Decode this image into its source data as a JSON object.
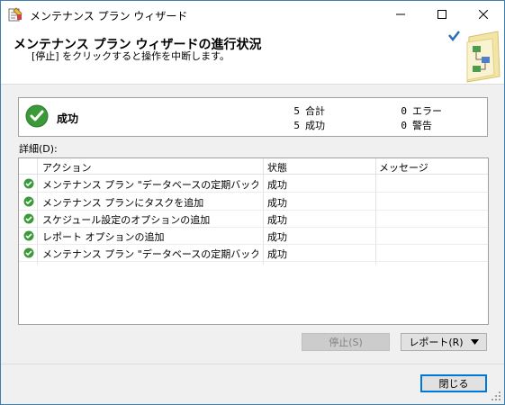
{
  "window": {
    "title": "メンテナンス プラン ウィザード",
    "controls": [
      "minimize-icon",
      "maximize-icon",
      "close-icon"
    ]
  },
  "header": {
    "title": "メンテナンス プラン ウィザードの進行状況",
    "subtitle": "[停止] をクリックすると操作を中断します。"
  },
  "status": {
    "label": "成功",
    "total_count": "5",
    "total_label": "合計",
    "success_count": "5",
    "success_label": "成功",
    "error_count": "0",
    "error_label": "エラー",
    "warning_count": "0",
    "warning_label": "警告"
  },
  "details": {
    "label": "詳細(D):",
    "columns": [
      "アクション",
      "状態",
      "メッセージ"
    ],
    "rows": [
      {
        "action": "メンテナンス プラン \"データベースの定期バックアッ...",
        "status": "成功",
        "message": ""
      },
      {
        "action": "メンテナンス プランにタスクを追加",
        "status": "成功",
        "message": ""
      },
      {
        "action": "スケジュール設定のオプションの追加",
        "status": "成功",
        "message": ""
      },
      {
        "action": "レポート オプションの追加",
        "status": "成功",
        "message": ""
      },
      {
        "action": "メンテナンス プラン \"データベースの定期バックアッ...",
        "status": "成功",
        "message": ""
      }
    ]
  },
  "buttons": {
    "stop": "停止(S)",
    "report": "レポート(R)",
    "close": "閉じる"
  },
  "colors": {
    "success_green": "#3a9a3a",
    "focus_border": "#0078d7"
  }
}
